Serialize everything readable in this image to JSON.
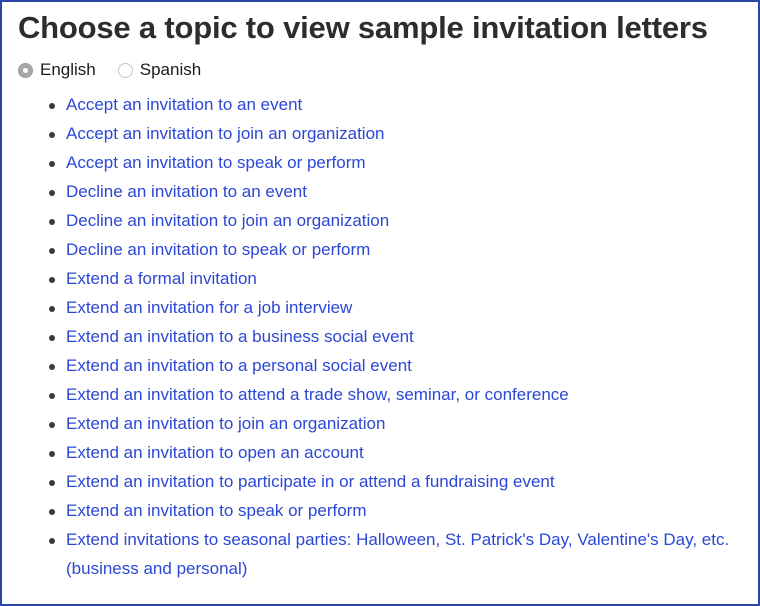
{
  "page": {
    "border_color": "#2a46a8",
    "background": "#ffffff",
    "title": "Choose a topic to view sample invitation letters"
  },
  "language_selector": {
    "name": "language",
    "selected": "English",
    "options": [
      {
        "label": "English",
        "value": "english",
        "checked": true
      },
      {
        "label": "Spanish",
        "value": "spanish",
        "checked": false
      }
    ]
  },
  "topics": {
    "link_color": "#2b47d6",
    "bullet_color": "#3a3a3a",
    "items": [
      {
        "label": "Accept an invitation to an event"
      },
      {
        "label": "Accept an invitation to join an organization"
      },
      {
        "label": "Accept an invitation to speak or perform"
      },
      {
        "label": "Decline an invitation to an event"
      },
      {
        "label": "Decline an invitation to join an organization"
      },
      {
        "label": "Decline an invitation to speak or perform"
      },
      {
        "label": "Extend a formal invitation"
      },
      {
        "label": "Extend an invitation for a job interview"
      },
      {
        "label": "Extend an invitation to a business social event"
      },
      {
        "label": "Extend an invitation to a personal social event"
      },
      {
        "label": "Extend an invitation to attend a trade show, seminar, or conference"
      },
      {
        "label": "Extend an invitation to join an organization"
      },
      {
        "label": "Extend an invitation to open an account"
      },
      {
        "label": "Extend an invitation to participate in or attend a fundraising event"
      },
      {
        "label": "Extend an invitation to speak or perform"
      },
      {
        "label": "Extend invitations to seasonal parties: Halloween, St. Patrick's Day, Valentine's Day, etc. (business and personal)"
      }
    ]
  }
}
